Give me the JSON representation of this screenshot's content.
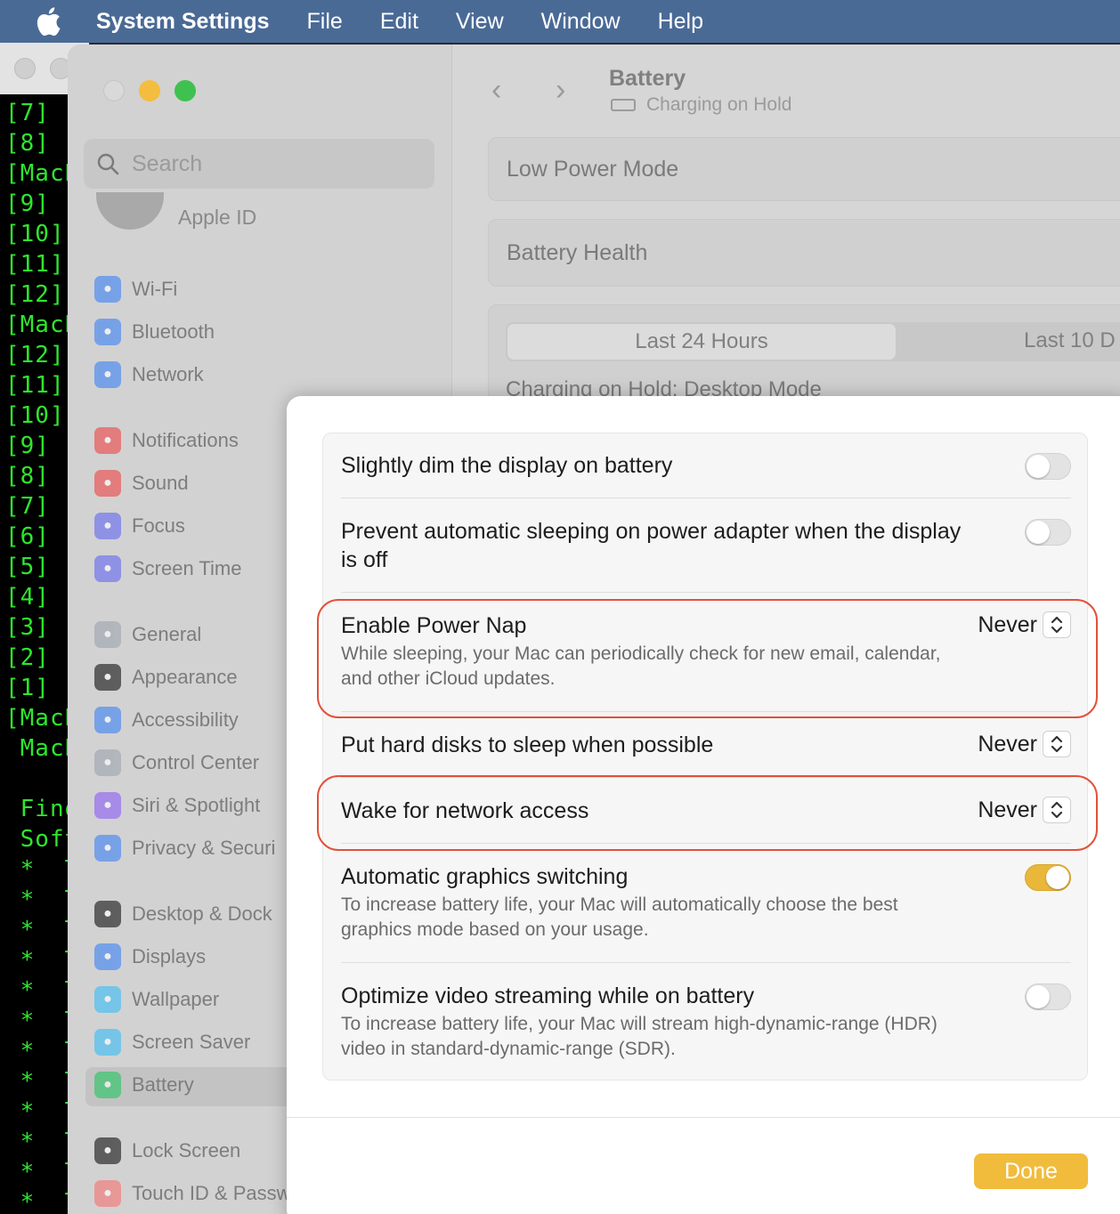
{
  "menubar": {
    "app_name": "System Settings",
    "items": [
      "File",
      "Edit",
      "View",
      "Window",
      "Help"
    ]
  },
  "terminal": {
    "lines": [
      "[7]",
      "[8]",
      "[MacB",
      "[9]",
      "[10]",
      "[11]",
      "[12]",
      "[MacB",
      "[12]",
      "[11]",
      "[10]",
      "[9]",
      "[8]",
      "[7]",
      "[6]",
      "[5]",
      "[4]",
      "[3]",
      "[2]",
      "[1]",
      "[MacB",
      " MacB",
      "",
      " Find",
      " Soft",
      " *  Ti",
      " *  Ti",
      " *  Ti",
      " *  Ti",
      " *  Ti",
      " *  Ti",
      " *  Ti",
      " *  Ti",
      " *  Ti",
      " *  Ti",
      " *  Ti",
      " *  Ti"
    ]
  },
  "sidebar": {
    "search_placeholder": "Search",
    "apple_id_label": "Apple ID",
    "items": [
      {
        "label": "Wi-Fi",
        "icon": "wifi-icon",
        "color": "#3b82f6"
      },
      {
        "label": "Bluetooth",
        "icon": "bluetooth-icon",
        "color": "#3b82f6"
      },
      {
        "label": "Network",
        "icon": "globe-icon",
        "color": "#3b82f6"
      },
      {
        "label": "Notifications",
        "icon": "bell-icon",
        "color": "#ef4444"
      },
      {
        "label": "Sound",
        "icon": "speaker-icon",
        "color": "#ef4444"
      },
      {
        "label": "Focus",
        "icon": "moon-icon",
        "color": "#6366f1"
      },
      {
        "label": "Screen Time",
        "icon": "hourglass-icon",
        "color": "#6366f1"
      },
      {
        "label": "General",
        "icon": "gear-icon",
        "color": "#9ca3af"
      },
      {
        "label": "Appearance",
        "icon": "appearance-icon",
        "color": "#111111"
      },
      {
        "label": "Accessibility",
        "icon": "accessibility-icon",
        "color": "#3b82f6"
      },
      {
        "label": "Control Center",
        "icon": "control-center-icon",
        "color": "#9ca3af"
      },
      {
        "label": "Siri & Spotlight",
        "icon": "siri-icon",
        "color": "#8b5cf6"
      },
      {
        "label": "Privacy & Securi",
        "icon": "hand-icon",
        "color": "#3b82f6"
      },
      {
        "label": "Desktop & Dock",
        "icon": "dock-icon",
        "color": "#111111"
      },
      {
        "label": "Displays",
        "icon": "sun-icon",
        "color": "#3b82f6"
      },
      {
        "label": "Wallpaper",
        "icon": "flower-icon",
        "color": "#38bdf8"
      },
      {
        "label": "Screen Saver",
        "icon": "screensaver-icon",
        "color": "#38bdf8"
      },
      {
        "label": "Battery",
        "icon": "battery-icon",
        "color": "#22c55e"
      },
      {
        "label": "Lock Screen",
        "icon": "lock-icon",
        "color": "#111111"
      },
      {
        "label": "Touch ID & Passw",
        "icon": "fingerprint-icon",
        "color": "#f87171"
      }
    ]
  },
  "main": {
    "title": "Battery",
    "subtitle": "Charging on Hold",
    "cards": [
      "Low Power Mode",
      "Battery Health"
    ],
    "segments": [
      "Last 24 Hours",
      "Last 10 D"
    ],
    "chart_title": "Charging on Hold: Desktop Mode"
  },
  "sheet": {
    "rows": [
      {
        "title": "Slightly dim the display on battery",
        "control": "toggle",
        "on": false
      },
      {
        "title": "Prevent automatic sleeping on power adapter when the display is off",
        "control": "toggle",
        "on": false
      },
      {
        "title": "Enable Power Nap",
        "desc": "While sleeping, your Mac can periodically check for new email, calendar, and other iCloud updates.",
        "control": "select",
        "value": "Never"
      },
      {
        "title": "Put hard disks to sleep when possible",
        "control": "select",
        "value": "Never"
      },
      {
        "title": "Wake for network access",
        "control": "select",
        "value": "Never"
      },
      {
        "title": "Automatic graphics switching",
        "desc": "To increase battery life, your Mac will automatically choose the best graphics mode based on your usage.",
        "control": "toggle",
        "on": true
      },
      {
        "title": "Optimize video streaming while on battery",
        "desc": "To increase battery life, your Mac will stream high-dynamic-range (HDR) video in standard-dynamic-range (SDR).",
        "control": "toggle",
        "on": false
      }
    ],
    "done_label": "Done"
  },
  "colors": {
    "accent": "#f1bb3c",
    "highlight": "#e2513a",
    "menubar": "#4a6a96"
  }
}
